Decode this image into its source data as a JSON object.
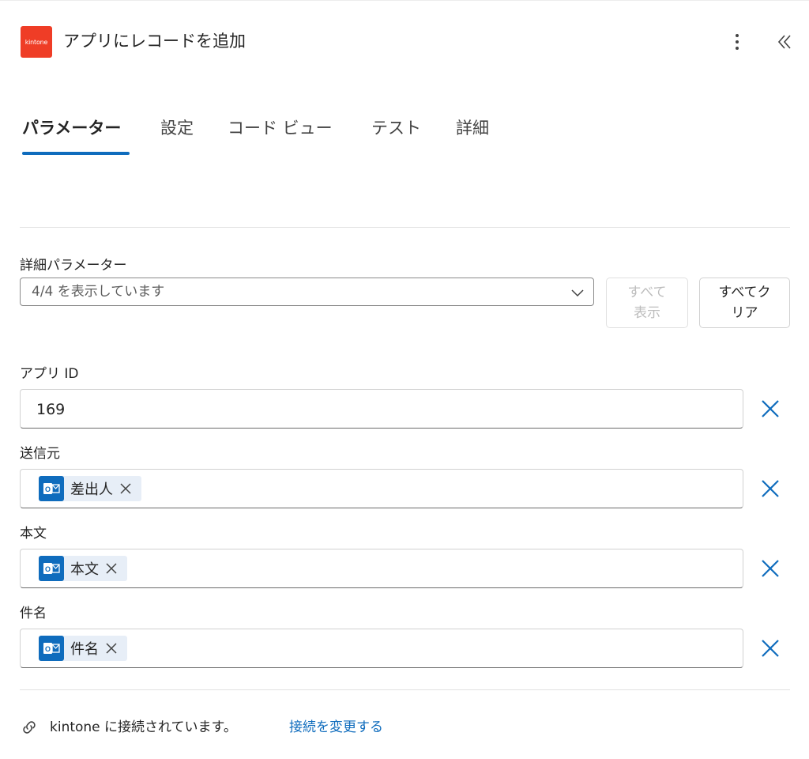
{
  "header": {
    "logo_text": "kintone",
    "title": "アプリにレコードを追加"
  },
  "tabs": [
    {
      "label": "パラメーター",
      "active": true
    },
    {
      "label": "設定",
      "active": false
    },
    {
      "label": "コード ビュー",
      "active": false
    },
    {
      "label": "テスト",
      "active": false
    },
    {
      "label": "詳細",
      "active": false
    }
  ],
  "advanced": {
    "label": "詳細パラメーター",
    "dropdown_value": "4/4 を表示しています",
    "show_all_label": "すべて\n表示",
    "clear_all_label": "すべてク\nリア"
  },
  "fields": {
    "app_id": {
      "label": "アプリ ID",
      "value": "169"
    },
    "sender": {
      "label": "送信元",
      "token": "差出人"
    },
    "body": {
      "label": "本文",
      "token": "本文"
    },
    "subject": {
      "label": "件名",
      "token": "件名"
    }
  },
  "footer": {
    "connection_text": "kintone に接続されています。",
    "change_link": "接続を変更する"
  },
  "colors": {
    "accent": "#0f6cbd",
    "logo": "#ef3d26",
    "token_bg": "#e7eef7"
  }
}
